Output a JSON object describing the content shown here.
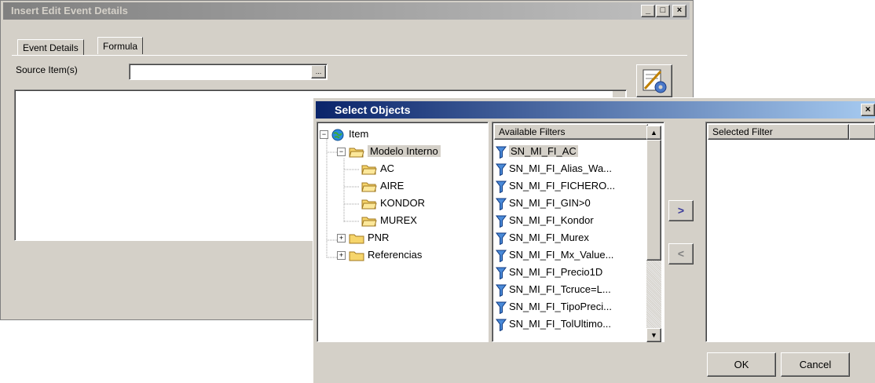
{
  "background_dialog": {
    "title": "Insert Edit Event Details",
    "caption_buttons": [
      "_",
      "□",
      "×"
    ],
    "tabs": [
      "Event Details",
      "Formula"
    ],
    "active_tab": "Formula",
    "source_label": "Source Item(s)",
    "source_value": "",
    "browse_button": "..."
  },
  "select_objects": {
    "title": "Select Objects",
    "close_label": "×",
    "tree": {
      "root": "Item",
      "items": [
        {
          "label": "Modelo Interno",
          "children": [
            "AC",
            "AIRE",
            "KONDOR",
            "MUREX"
          ]
        },
        {
          "label": "PNR",
          "children": []
        },
        {
          "label": "Referencias",
          "children": []
        }
      ],
      "selected": "Modelo Interno"
    },
    "available": {
      "header": "Available Filters",
      "items": [
        "SN_MI_FI_AC",
        "SN_MI_FI_Alias_Wa...",
        "SN_MI_FI_FICHERO...",
        "SN_MI_FI_GIN>0",
        "SN_MI_FI_Kondor",
        "SN_MI_FI_Murex",
        "SN_MI_FI_Mx_Value...",
        "SN_MI_FI_Precio1D",
        "SN_MI_FI_Tcruce=L...",
        "SN_MI_FI_TipoPreci...",
        "SN_MI_FI_TolUltimo..."
      ],
      "selected_index": 0
    },
    "add_button": ">",
    "remove_button": "<",
    "selected": {
      "header": "Selected Filter",
      "items": []
    },
    "ok_label": "OK",
    "cancel_label": "Cancel"
  },
  "colors": {
    "face": "#d4d0c8",
    "active_title_start": "#0a246a",
    "active_title_end": "#a6caf0",
    "inactive_title": "#808080"
  }
}
